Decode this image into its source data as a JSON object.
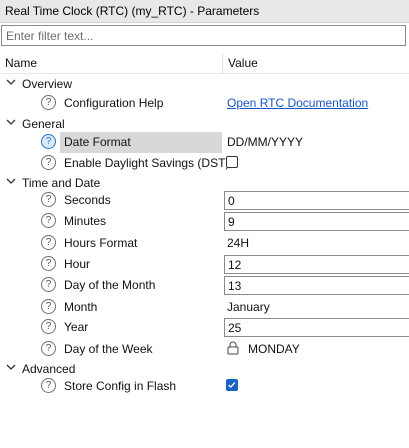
{
  "window": {
    "title": "Real Time Clock (RTC) (my_RTC) - Parameters"
  },
  "filter": {
    "placeholder": "Enter filter text..."
  },
  "columns": {
    "name": "Name",
    "value": "Value"
  },
  "categories": {
    "overview": "Overview",
    "general": "General",
    "time_and_date": "Time and Date",
    "advanced": "Advanced"
  },
  "params": {
    "config_help": {
      "label": "Configuration Help",
      "value": "Open RTC Documentation"
    },
    "date_format": {
      "label": "Date Format",
      "value": "DD/MM/YYYY"
    },
    "dst": {
      "label": "Enable Daylight Savings (DST)",
      "checked": false
    },
    "seconds": {
      "label": "Seconds",
      "value": "0"
    },
    "minutes": {
      "label": "Minutes",
      "value": "9"
    },
    "hours_format": {
      "label": "Hours Format",
      "value": "24H"
    },
    "hour": {
      "label": "Hour",
      "value": "12"
    },
    "day_of_month": {
      "label": "Day of the Month",
      "value": "13"
    },
    "month": {
      "label": "Month",
      "value": "January"
    },
    "year": {
      "label": "Year",
      "value": "25"
    },
    "day_of_week": {
      "label": "Day of the Week",
      "value": "MONDAY"
    },
    "store_flash": {
      "label": "Store Config in Flash",
      "checked": true
    }
  },
  "icons": {
    "help": "question-circle-icon",
    "expand": "chevron-down-icon",
    "lock": "lock-icon",
    "check": "check-icon"
  },
  "colors": {
    "link": "#1a55c7",
    "checkbox_on": "#1a63c5",
    "help_selected": "#1f75c9"
  },
  "help_glyph": "?"
}
